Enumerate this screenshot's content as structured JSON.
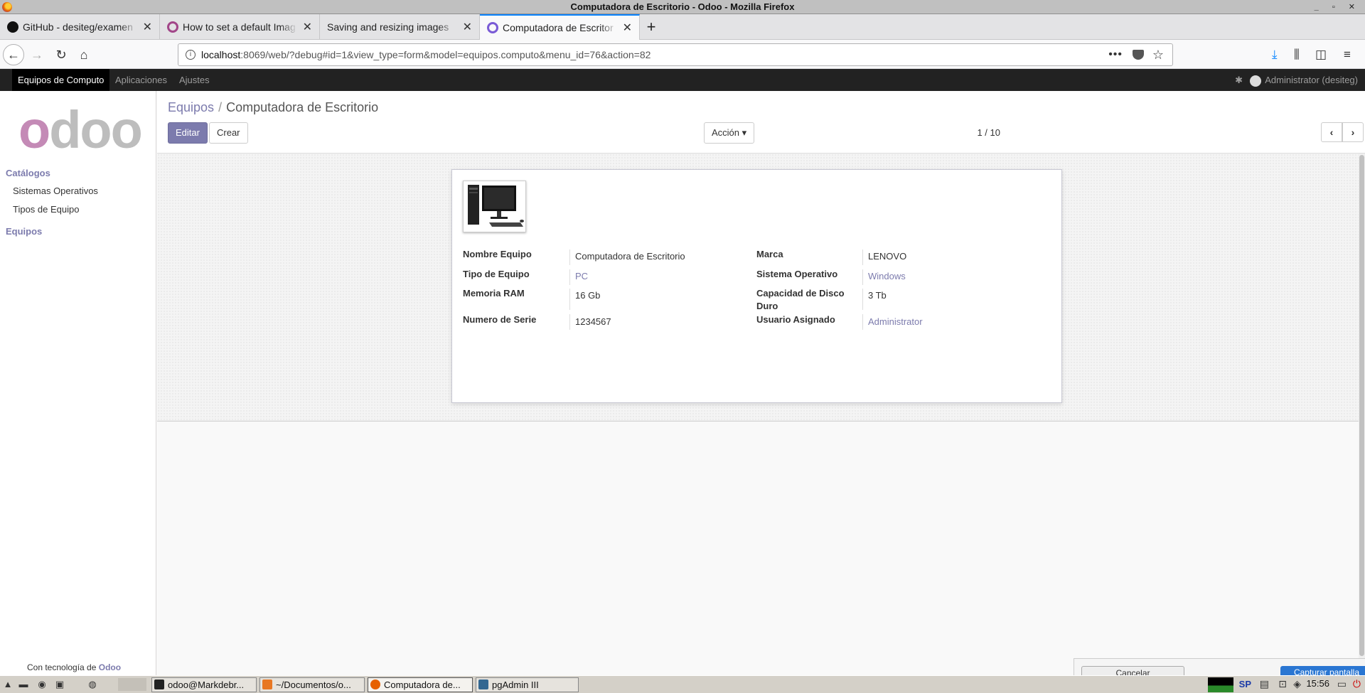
{
  "window": {
    "title": "Computadora de Escritorio - Odoo - Mozilla Firefox"
  },
  "tabs": [
    {
      "label": "GitHub - desiteg/examen"
    },
    {
      "label": "How to set a default Imag"
    },
    {
      "label": "Saving and resizing images"
    },
    {
      "label": "Computadora de Escritor"
    }
  ],
  "url": {
    "host": "localhost",
    "rest": ":8069/web/?debug#id=1&view_type=form&model=equipos.computo&menu_id=76&action=82"
  },
  "odoo_menu": {
    "items": [
      "Equipos de Computo",
      "Aplicaciones",
      "Ajustes"
    ],
    "user": "Administrator (desiteg)"
  },
  "sidebar": {
    "sections": [
      {
        "title": "Catálogos",
        "items": [
          "Sistemas Operativos",
          "Tipos de Equipo"
        ]
      },
      {
        "title": "Equipos",
        "items": []
      }
    ],
    "powered_prefix": "Con tecnología de",
    "powered_brand": "Odoo"
  },
  "breadcrumb": {
    "parent": "Equipos",
    "current": "Computadora de Escritorio"
  },
  "buttons": {
    "edit": "Editar",
    "create": "Crear",
    "action": "Acción"
  },
  "pager": {
    "text": "1 / 10"
  },
  "form": {
    "left": [
      {
        "label": "Nombre Equipo",
        "value": "Computadora de Escritorio",
        "link": false
      },
      {
        "label": "Tipo de Equipo",
        "value": "PC",
        "link": true
      },
      {
        "label": "Memoria RAM",
        "value": "16 Gb",
        "link": false
      },
      {
        "label": "Numero de Serie",
        "value": "1234567",
        "link": false
      }
    ],
    "right": [
      {
        "label": "Marca",
        "value": "LENOVO",
        "link": false
      },
      {
        "label": "Sistema Operativo",
        "value": "Windows",
        "link": true
      },
      {
        "label": "Capacidad de Disco Duro",
        "value": "3 Tb",
        "link": false
      },
      {
        "label": "Usuario Asignado",
        "value": "Administrator",
        "link": true
      }
    ]
  },
  "dialog_peek": {
    "cancel": "Cancelar",
    "capture": "Capturar pantalla"
  },
  "taskbar": {
    "tasks": [
      "odoo@Markdebr...",
      "~/Documentos/o...",
      "Computadora de...",
      "pgAdmin III"
    ],
    "lang": "SP",
    "clock": "15:56"
  }
}
